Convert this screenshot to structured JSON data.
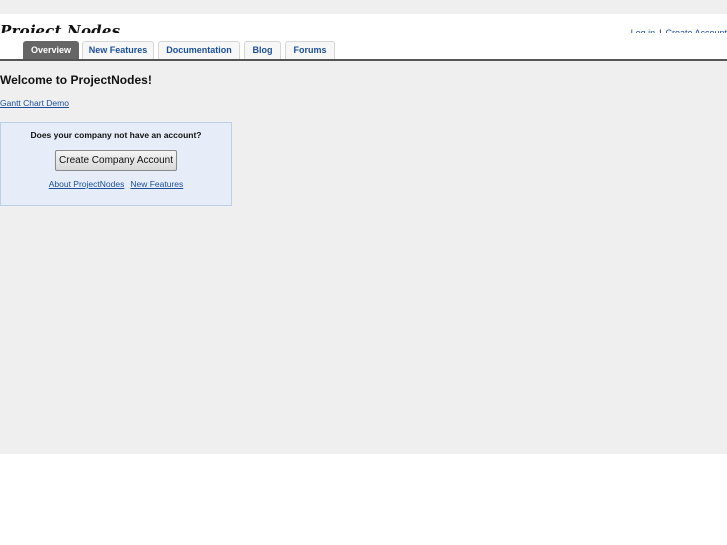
{
  "header": {
    "logo_text": "Project Nodes",
    "login_label": "Log in",
    "separator": "|",
    "create_account_label": "Create Account"
  },
  "tabs": [
    {
      "label": "Overview",
      "active": true
    },
    {
      "label": "New Features",
      "active": false
    },
    {
      "label": "Documentation",
      "active": false
    },
    {
      "label": "Blog",
      "active": false
    },
    {
      "label": "Forums",
      "active": false
    }
  ],
  "main": {
    "heading": "Welcome to ProjectNodes!",
    "demo_link": "Gantt Chart Demo"
  },
  "signup": {
    "question": "Does your company not have an account?",
    "button_label": "Create Company Account",
    "about_link": "About ProjectNodes",
    "features_link": "New Features"
  },
  "colors": {
    "link": "#1a4f9c",
    "active_tab": "#666666",
    "page_background": "#efefef",
    "signup_background": "#e7edf8"
  }
}
